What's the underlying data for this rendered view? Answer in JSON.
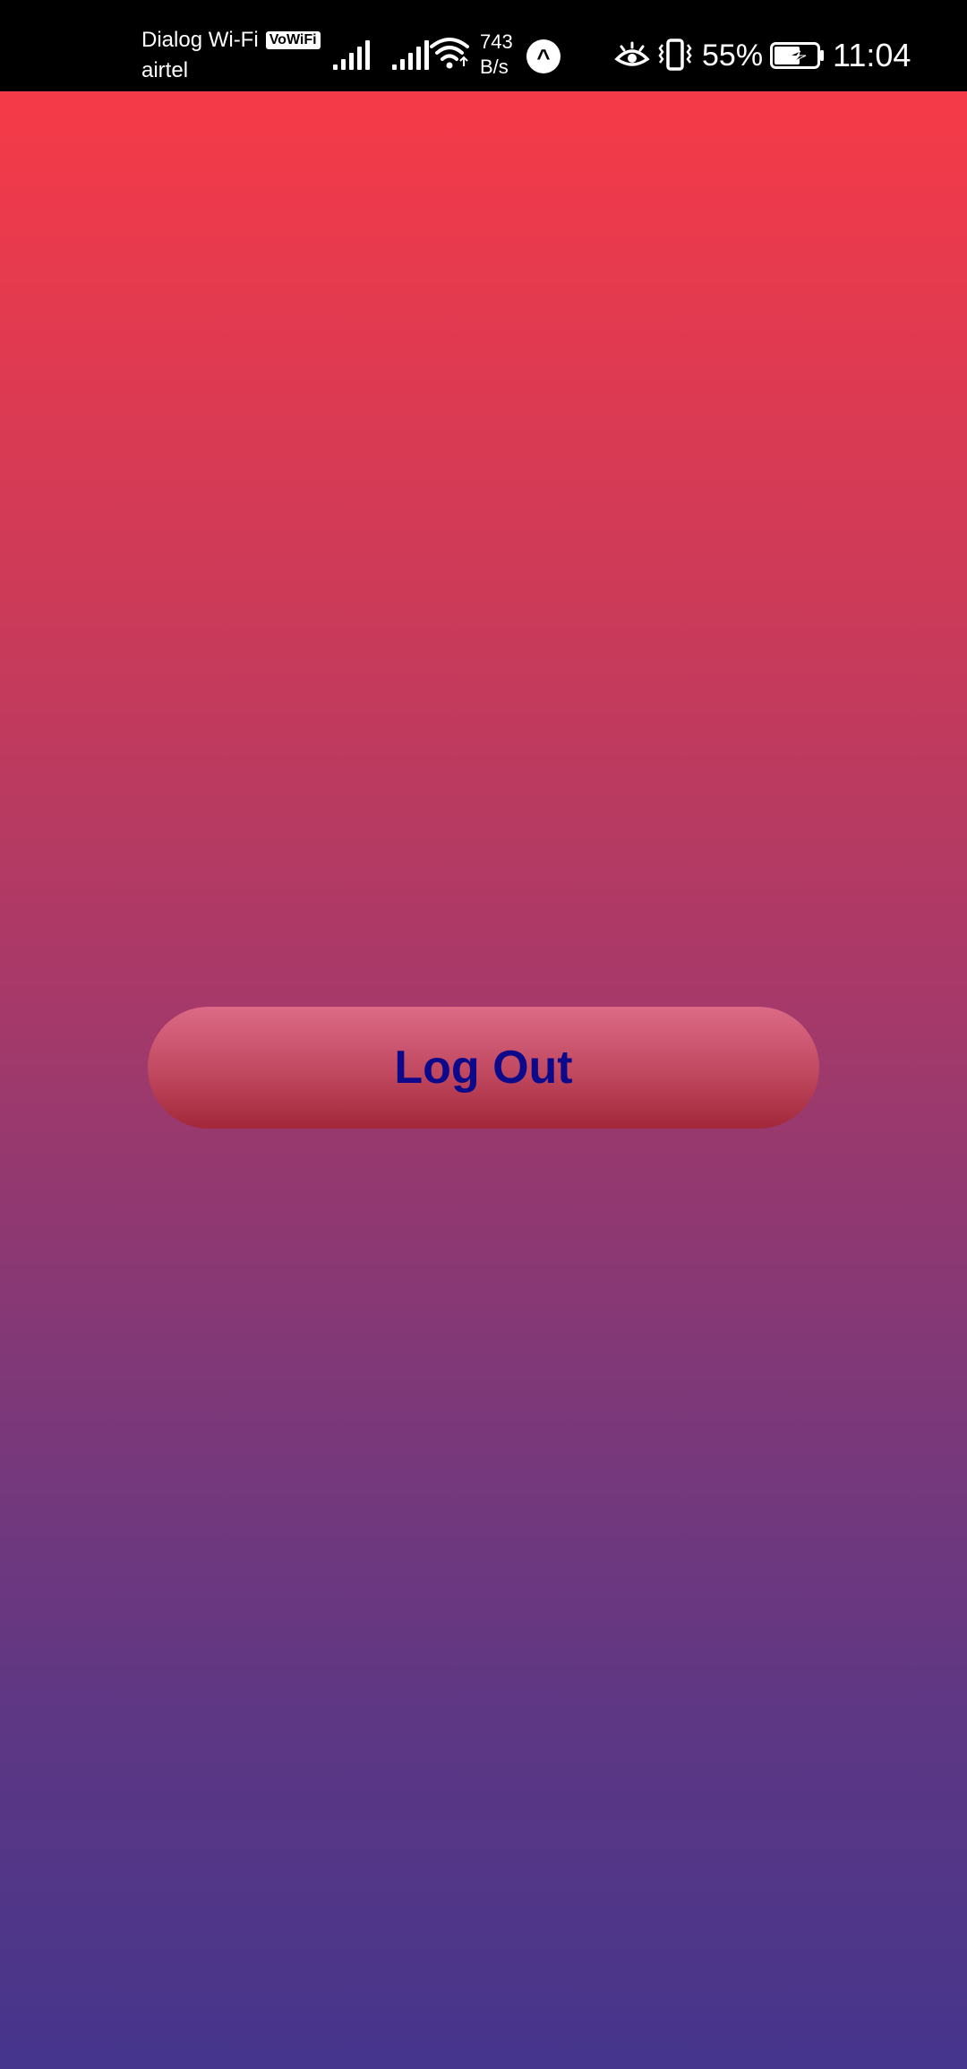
{
  "status_bar": {
    "carrier_primary": "Dialog Wi-Fi",
    "vowifi_badge": "VoWiFi",
    "carrier_secondary": "airtel",
    "net_speed_value": "743",
    "net_speed_unit": "B/s",
    "notification_icon": "chevron-up-icon",
    "battery_percent": "55%",
    "time": "11:04"
  },
  "main": {
    "logout_label": "Log Out"
  },
  "colors": {
    "gradient_top": "#f53a48",
    "gradient_bottom": "#45358c",
    "button_text": "#0c0a8a"
  }
}
